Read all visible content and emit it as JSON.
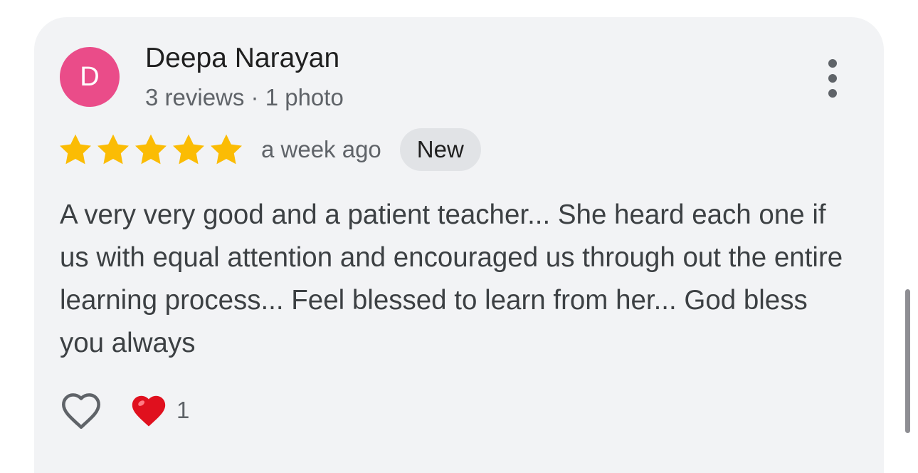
{
  "review": {
    "author": {
      "initial": "D",
      "name": "Deepa Narayan",
      "meta": "3 reviews · 1 photo",
      "avatar_color": "#ea4c89"
    },
    "rating": {
      "value": 5,
      "max": 5,
      "star_color": "#fbbc04"
    },
    "time": "a week ago",
    "badge": "New",
    "text": "A very very good and a patient teacher... She heard each one if us with equal attention and encouraged us through out the entire learning process... Feel blessed to learn from her... God bless you always",
    "reactions": {
      "like_icon": "heart-outline-icon",
      "reaction_icon": "red-heart-icon",
      "count": "1"
    },
    "menu_icon": "more-vertical-icon"
  }
}
